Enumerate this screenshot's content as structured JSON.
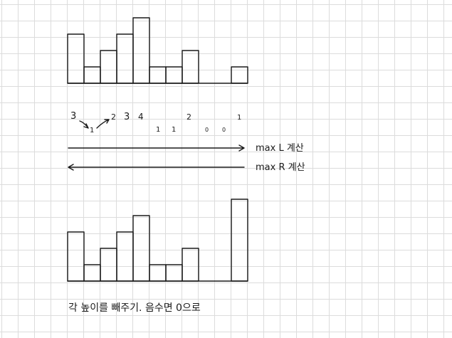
{
  "top_histogram": {
    "heights": [
      3,
      1,
      2,
      3,
      4,
      1,
      1,
      2,
      0,
      0,
      1
    ]
  },
  "height_labels": [
    "3",
    "1",
    "2",
    "3",
    "4",
    "1",
    "1",
    "2",
    "0",
    "0",
    "1"
  ],
  "arrow_right_label": "max L 계산",
  "arrow_left_label": "max R 계산",
  "bottom_histogram": {
    "heights": [
      3,
      1,
      2,
      3,
      4,
      1,
      1,
      2,
      0,
      0,
      5
    ]
  },
  "caption": "각 높이를 빼주기. 음수면 0으로"
}
